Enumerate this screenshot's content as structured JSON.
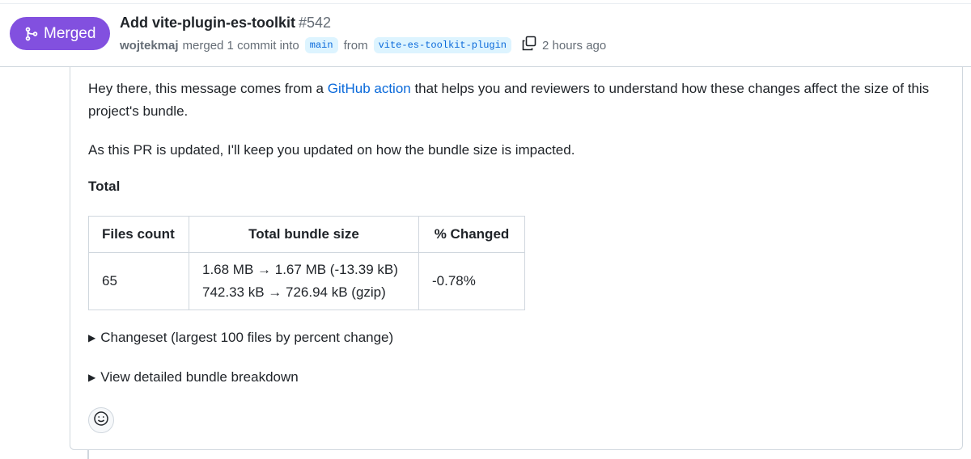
{
  "header": {
    "state_label": "Merged",
    "title": "Add vite-plugin-es-toolkit",
    "number": "#542",
    "author": "wojtekmaj",
    "merged_text": "merged 1 commit into",
    "base_branch": "main",
    "from_text": "from",
    "head_branch": "vite-es-toolkit-plugin",
    "time": "2 hours ago",
    "icons": {
      "state": "git-merge-icon",
      "copy": "copy-icon"
    },
    "colors": {
      "merged": "#8250df",
      "link": "#0969da",
      "branch_bg": "#ddf4ff"
    }
  },
  "comment": {
    "intro_before_link": "Hey there, this message comes from a ",
    "intro_link": "GitHub action",
    "intro_after_link": " that helps you and reviewers to understand how these changes affect the size of this project's bundle.",
    "update_note": "As this PR is updated, I'll keep you updated on how the bundle size is impacted.",
    "total_heading": "Total",
    "table": {
      "headers": [
        "Files count",
        "Total bundle size",
        "% Changed"
      ],
      "rows": [
        {
          "files_count": "65",
          "size_line1": "1.68 MB → 1.67 MB (-13.39 kB)",
          "size_line2": "742.33 kB → 726.94 kB (gzip)",
          "changed": "-0.78%"
        }
      ]
    },
    "details": [
      {
        "summary": "Changeset (largest 100 files by percent change)"
      },
      {
        "summary": "View detailed bundle breakdown"
      }
    ],
    "reaction_icon": "smiley-icon"
  }
}
